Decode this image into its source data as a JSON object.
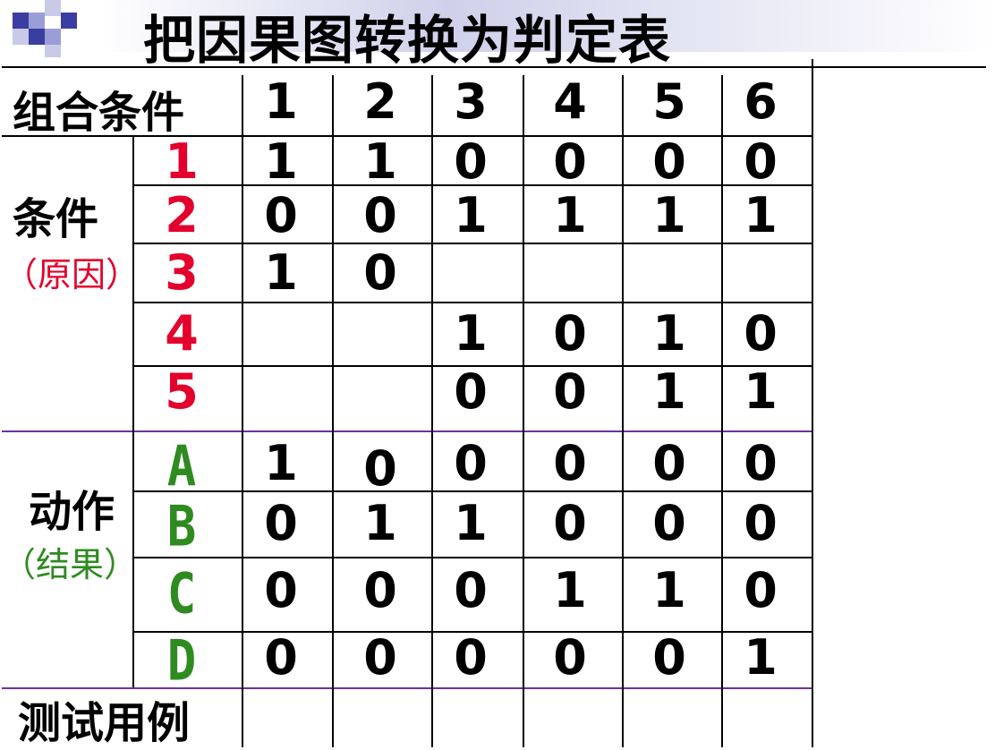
{
  "title": "把因果图转换为判定表",
  "header_label": "组合条件",
  "columns": [
    "1",
    "2",
    "3",
    "4",
    "5",
    "6"
  ],
  "conditions_label": "条件",
  "conditions_sub": "（原因）",
  "actions_label": "动作",
  "actions_sub": "（结果）",
  "test_cases_label": "测试用例",
  "condition_rows": [
    {
      "id": "1",
      "values": [
        "1",
        "1",
        "0",
        "0",
        "0",
        "0"
      ]
    },
    {
      "id": "2",
      "values": [
        "0",
        "0",
        "1",
        "1",
        "1",
        "1"
      ]
    },
    {
      "id": "3",
      "values": [
        "1",
        "0",
        "",
        "",
        "",
        ""
      ]
    },
    {
      "id": "4",
      "values": [
        "",
        "",
        "1",
        "0",
        "1",
        "0"
      ]
    },
    {
      "id": "5",
      "values": [
        "",
        "",
        "0",
        "0",
        "1",
        "1"
      ]
    }
  ],
  "action_rows": [
    {
      "id": "A",
      "values": [
        "1",
        "0",
        "0",
        "0",
        "0",
        "0"
      ]
    },
    {
      "id": "B",
      "values": [
        "0",
        "1",
        "1",
        "0",
        "0",
        "0"
      ]
    },
    {
      "id": "C",
      "values": [
        "0",
        "0",
        "0",
        "1",
        "1",
        "0"
      ]
    },
    {
      "id": "D",
      "values": [
        "0",
        "0",
        "0",
        "0",
        "0",
        "1"
      ]
    }
  ],
  "colors": {
    "condition_id": "#e3002c",
    "action_id": "#2e8b1f",
    "section_divider": "#7030a0",
    "title_band": "#cfd0ea"
  }
}
